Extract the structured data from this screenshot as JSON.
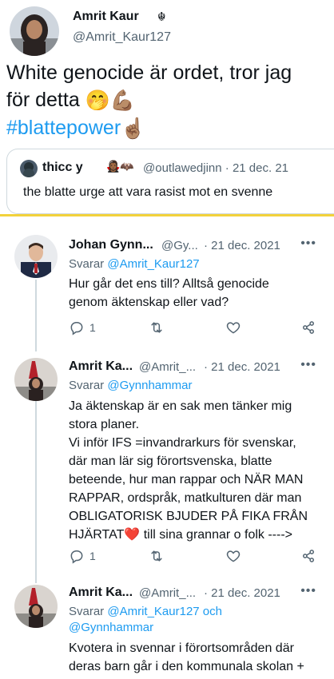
{
  "main_tweet": {
    "author_name": "Amrit Kaur",
    "author_badge": "☬",
    "handle": "@Amrit_Kaur127",
    "text_line1": "White genocide är ordet, tror jag",
    "text_line2": "för detta",
    "emoji1": "🤭",
    "emoji2": "💪🏽",
    "hashtag": "#blattepower",
    "emoji3": "☝🏽"
  },
  "quoted_tweet": {
    "author_name": "thicc y",
    "badges": "🧛🏾‍♀️🦇",
    "handle": "@outlawedjinn · 21 dec. 21",
    "text": "the blatte urge att vara rasist mot en svenne"
  },
  "replies": [
    {
      "author_name": "Johan Gynn...",
      "handle": "@Gy...",
      "date": "· 21 dec. 2021",
      "more": "•••",
      "replying_prefix": "Svarar",
      "replying_to": "@Amrit_Kaur127",
      "body_lines": [
        "Hur går det ens till? Alltså genocide",
        "genom äktenskap eller vad?"
      ],
      "reply_count": "1",
      "retweet_count": "",
      "like_count": ""
    },
    {
      "author_name": "Amrit Ka...",
      "handle": "@Amrit_...",
      "date": "· 21 dec. 2021",
      "more": "•••",
      "replying_prefix": "Svarar",
      "replying_to": "@Gynnhammar",
      "body_lines": [
        "Ja äktenskap är en sak men tänker mig",
        "stora planer.",
        "Vi inför IFS =invandrarkurs för svenskar,",
        "där man lär sig förortsvenska, blatte",
        "beteende, hur man rappar och NÄR MAN",
        "RAPPAR, ordspråk, matkulturen där man",
        "OBLIGATORISK BJUDER PÅ FIKA FRÅN",
        "HJÄRTAT❤️ till sina grannar o folk ---->"
      ],
      "reply_count": "1",
      "retweet_count": "",
      "like_count": ""
    },
    {
      "author_name": "Amrit Ka...",
      "handle": "@Amrit_...",
      "date": "· 21 dec. 2021",
      "more": "•••",
      "replying_prefix": "Svarar",
      "replying_to": "@Amrit_Kaur127 och",
      "replying_to2": "@Gynnhammar",
      "body_lines": [
        "Kvotera in svennar i förortsområden där",
        "deras barn går i den kommunala skolan +"
      ]
    }
  ],
  "colors": {
    "accent": "#1d9bf0",
    "secondary_text": "#536471",
    "divider": "#f2d23b",
    "thread_line": "#cfd9de"
  },
  "icons": [
    "reply-icon",
    "retweet-icon",
    "like-icon",
    "share-icon",
    "more-icon"
  ]
}
